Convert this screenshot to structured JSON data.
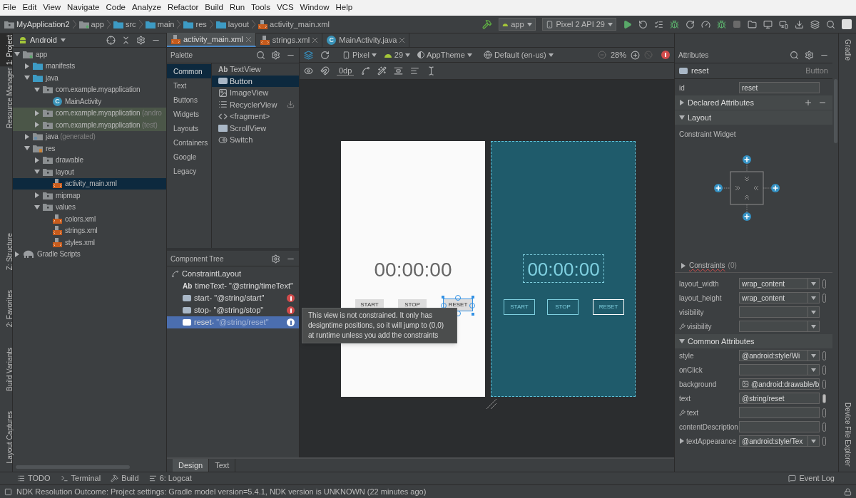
{
  "menu": [
    "File",
    "Edit",
    "View",
    "Navigate",
    "Code",
    "Analyze",
    "Refactor",
    "Build",
    "Run",
    "Tools",
    "VCS",
    "Window",
    "Help"
  ],
  "breadcrumb": [
    {
      "label": "MyApplication2",
      "kind": "project"
    },
    {
      "label": "app",
      "kind": "module"
    },
    {
      "label": "src",
      "kind": "folder"
    },
    {
      "label": "main",
      "kind": "folder"
    },
    {
      "label": "res",
      "kind": "folder"
    },
    {
      "label": "layout",
      "kind": "folder"
    },
    {
      "label": "activity_main.xml",
      "kind": "xml"
    }
  ],
  "run_config": "app",
  "device": "Pixel 2 API 29",
  "left_tool_windows": [
    {
      "label": "1: Project",
      "selected": true
    },
    {
      "label": "Resource Manager",
      "selected": false
    },
    {
      "label": "Z: Structure",
      "selected": false
    },
    {
      "label": "2: Favorites",
      "selected": false
    },
    {
      "label": "Build Variants",
      "selected": false
    },
    {
      "label": "Layout Captures",
      "selected": false
    }
  ],
  "right_tool_windows": [
    {
      "label": "Gradle"
    },
    {
      "label": "Device File Explorer"
    }
  ],
  "project_panel": {
    "view": "Android",
    "tree": [
      {
        "label": "app",
        "kind": "module",
        "expanded": true,
        "selected": false,
        "children": [
          {
            "label": "manifests",
            "kind": "folder",
            "expanded": false,
            "selected": false
          },
          {
            "label": "java",
            "kind": "folder",
            "expanded": true,
            "selected": false,
            "children": [
              {
                "label": "com.example.myapplication",
                "kind": "package",
                "expanded": true,
                "selected": false,
                "children": [
                  {
                    "label": "MainActivity",
                    "kind": "class",
                    "icon_letter": "C",
                    "selected": false
                  }
                ]
              },
              {
                "label": "com.example.myapplication",
                "suffix": "(andro",
                "kind": "test-package",
                "expanded": false,
                "selected": false
              },
              {
                "label": "com.example.myapplication",
                "suffix": "(test)",
                "kind": "test-package",
                "expanded": false,
                "selected": false
              }
            ]
          },
          {
            "label": "java",
            "suffix": "(generated)",
            "kind": "generated",
            "expanded": false,
            "selected": false
          },
          {
            "label": "res",
            "kind": "res",
            "expanded": true,
            "selected": false,
            "children": [
              {
                "label": "drawable",
                "kind": "package",
                "expanded": false,
                "selected": false
              },
              {
                "label": "layout",
                "kind": "package",
                "expanded": true,
                "selected": false,
                "children": [
                  {
                    "label": "activity_main.xml",
                    "kind": "xml",
                    "selected": true
                  }
                ]
              },
              {
                "label": "mipmap",
                "kind": "package",
                "expanded": false,
                "selected": false
              },
              {
                "label": "values",
                "kind": "package",
                "expanded": true,
                "selected": false,
                "children": [
                  {
                    "label": "colors.xml",
                    "kind": "xml",
                    "selected": false
                  },
                  {
                    "label": "strings.xml",
                    "kind": "xml",
                    "selected": false
                  },
                  {
                    "label": "styles.xml",
                    "kind": "xml",
                    "selected": false
                  }
                ]
              }
            ]
          }
        ]
      },
      {
        "label": "Gradle Scripts",
        "kind": "gradle",
        "expanded": false,
        "selected": false
      }
    ]
  },
  "editor_tabs": [
    {
      "label": "activity_main.xml",
      "kind": "xml",
      "selected": true
    },
    {
      "label": "strings.xml",
      "kind": "xml",
      "selected": false
    },
    {
      "label": "MainActivity.java",
      "kind": "java",
      "icon_letter": "C",
      "selected": false
    }
  ],
  "palette": {
    "title": "Palette",
    "categories": [
      {
        "label": "Common",
        "selected": true
      },
      {
        "label": "Text",
        "selected": false
      },
      {
        "label": "Buttons",
        "selected": false
      },
      {
        "label": "Widgets",
        "selected": false
      },
      {
        "label": "Layouts",
        "selected": false
      },
      {
        "label": "Containers",
        "selected": false
      },
      {
        "label": "Google",
        "selected": false
      },
      {
        "label": "Legacy",
        "selected": false
      }
    ],
    "items": [
      {
        "label": "TextView",
        "kind": "text",
        "badge": "Ab",
        "selected": false
      },
      {
        "label": "Button",
        "kind": "button",
        "selected": true
      },
      {
        "label": "ImageView",
        "kind": "image",
        "selected": false
      },
      {
        "label": "RecyclerView",
        "kind": "list",
        "download": true,
        "selected": false
      },
      {
        "label": "<fragment>",
        "kind": "fragment",
        "selected": false
      },
      {
        "label": "ScrollView",
        "kind": "scroll",
        "selected": false
      },
      {
        "label": "Switch",
        "kind": "switch",
        "selected": false
      }
    ]
  },
  "component_tree": {
    "title": "Component Tree",
    "root": {
      "label": "ConstraintLayout",
      "selected": false,
      "children": [
        {
          "label": "timeText-",
          "value": "\"@string/timeText\"",
          "kind": "text",
          "badge": "Ab",
          "warning": false,
          "selected": false
        },
        {
          "label": "start-",
          "value": "\"@string/start\"",
          "kind": "button",
          "warning": true,
          "selected": false
        },
        {
          "label": "stop-",
          "value": "\"@string/stop\"",
          "kind": "button",
          "warning": true,
          "selected": false
        },
        {
          "label": "reset-",
          "value": "\"@string/reset\"",
          "kind": "button",
          "warning": true,
          "selected": true
        }
      ]
    }
  },
  "design_toolbar": {
    "device": "Pixel",
    "api": "29",
    "theme": "AppTheme",
    "locale": "Default (en-us)",
    "zoom": "28%",
    "margin": "0dp"
  },
  "design_preview": {
    "time": "00:00:00",
    "buttons": [
      {
        "label": "START",
        "selected": false
      },
      {
        "label": "STOP",
        "selected": false
      },
      {
        "label": "RESET",
        "selected": true
      }
    ]
  },
  "blueprint_preview": {
    "time": "00:00:00",
    "buttons": [
      {
        "label": "START",
        "selected": false
      },
      {
        "label": "STOP",
        "selected": false
      },
      {
        "label": "RESET",
        "selected": true
      }
    ]
  },
  "tooltip": "This view is not constrained. It only has designtime positions, so it will jump to (0,0) at runtime unless you add the constraints",
  "attributes": {
    "title": "Attributes",
    "component": "reset",
    "component_type": "Button",
    "rows": [
      {
        "kind": "field",
        "label": "id",
        "value": "reset"
      },
      {
        "kind": "section",
        "label": "Declared Attributes",
        "expanded": false,
        "actions": true
      },
      {
        "kind": "section",
        "label": "Layout",
        "expanded": true,
        "actions": false
      },
      {
        "kind": "constraint-widget",
        "label": "Constraint Widget"
      },
      {
        "kind": "subsection",
        "label": "Constraints",
        "count": "(0)",
        "expanded": false
      },
      {
        "kind": "dropdown",
        "label": "layout_width",
        "value": "wrap_content",
        "picker": true,
        "filled": false
      },
      {
        "kind": "dropdown",
        "label": "layout_height",
        "value": "wrap_content",
        "picker": true,
        "filled": false
      },
      {
        "kind": "dropdown",
        "label": "visibility"
      },
      {
        "kind": "dropdown",
        "label": "visibility",
        "tools": true
      },
      {
        "kind": "section",
        "label": "Common Attributes",
        "expanded": true,
        "actions": false
      },
      {
        "kind": "dropdown",
        "label": "style",
        "value": "@android:style/Wi",
        "picker": true,
        "filled": false
      },
      {
        "kind": "dropdown",
        "label": "onClick",
        "picker": true,
        "filled": false
      },
      {
        "kind": "field",
        "label": "background",
        "value": "@android:drawable/b",
        "image": true,
        "picker": true,
        "filled": false
      },
      {
        "kind": "field",
        "label": "text",
        "value": "@string/reset",
        "picker": true,
        "filled": true
      },
      {
        "kind": "field",
        "label": "text",
        "tools": true,
        "picker": true,
        "filled": false
      },
      {
        "kind": "field",
        "label": "contentDescription",
        "picker": true,
        "filled": false
      },
      {
        "kind": "dropdown",
        "label": "textAppearance",
        "value": "@android:style/Tex",
        "expanded": false,
        "picker": true,
        "filled": false
      }
    ]
  },
  "bottom_tabs": [
    {
      "label": "Design",
      "selected": true
    },
    {
      "label": "Text",
      "selected": false
    }
  ],
  "tool_buttons": [
    {
      "label": "TODO",
      "kind": "todo"
    },
    {
      "label": "Terminal",
      "kind": "terminal"
    },
    {
      "label": "Build",
      "kind": "build"
    },
    {
      "label": "6: Logcat",
      "kind": "logcat"
    }
  ],
  "event_log": "Event Log",
  "status": "NDK Resolution Outcome: Project settings: Gradle model version=5.4.1, NDK version is UNKNOWN (22 minutes ago)"
}
